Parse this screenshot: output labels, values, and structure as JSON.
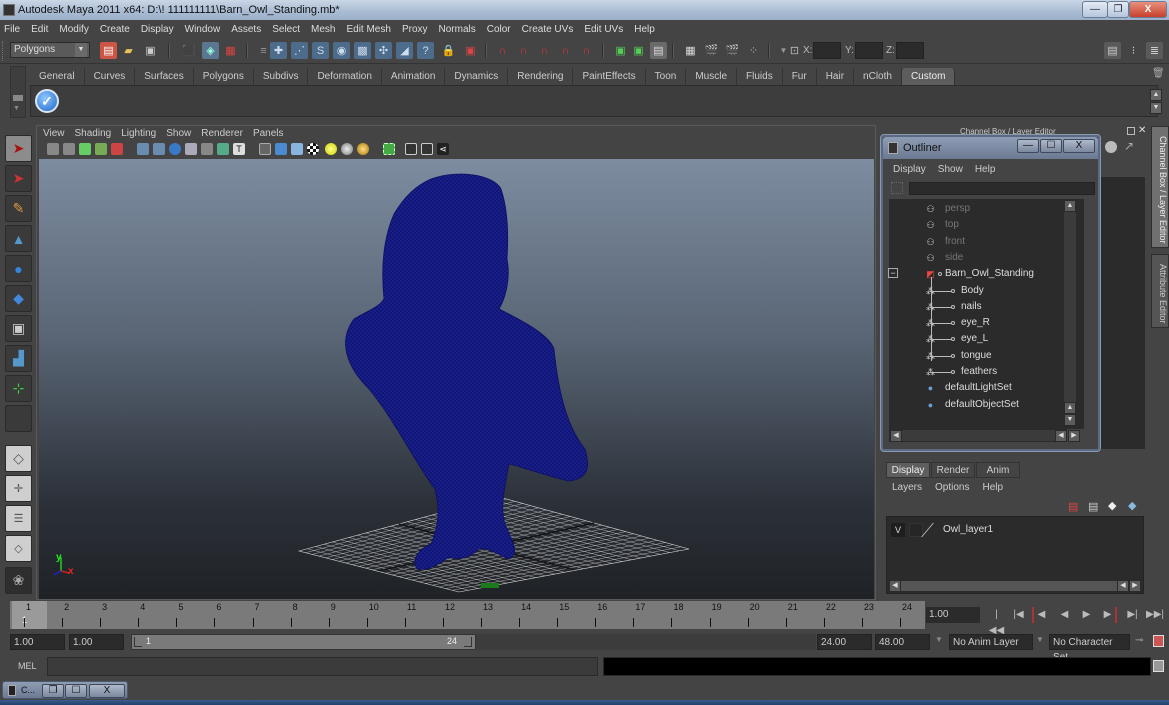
{
  "window": {
    "title": "Autodesk Maya 2011 x64: D:\\! 111111111\\Barn_Owl_Standing.mb*",
    "controls": {
      "minimize": "—",
      "restore": "❐",
      "close": "X"
    }
  },
  "menubar": [
    "File",
    "Edit",
    "Modify",
    "Create",
    "Display",
    "Window",
    "Assets",
    "Select",
    "Mesh",
    "Edit Mesh",
    "Proxy",
    "Normals",
    "Color",
    "Create UVs",
    "Edit UVs",
    "Help"
  ],
  "statusline": {
    "menu_set": "Polygons",
    "xyz_labels": [
      "X:",
      "Y:",
      "Z:"
    ],
    "xyz_values": [
      "",
      "",
      ""
    ]
  },
  "shelf": {
    "tabs": [
      "General",
      "Curves",
      "Surfaces",
      "Polygons",
      "Subdivs",
      "Deformation",
      "Animation",
      "Dynamics",
      "Rendering",
      "PaintEffects",
      "Toon",
      "Muscle",
      "Fluids",
      "Fur",
      "Hair",
      "nCloth",
      "Custom"
    ],
    "active_tab": "Custom",
    "items": [
      "checkmark-shelf-icon"
    ]
  },
  "viewport": {
    "menu": [
      "View",
      "Shading",
      "Lighting",
      "Show",
      "Renderer",
      "Panels"
    ],
    "axis_labels": {
      "y": "y",
      "x": "x"
    },
    "scene_object": "Barn_Owl_Standing",
    "wireframe_color": "#10157a"
  },
  "outliner": {
    "title": "Outliner",
    "menu": [
      "Display",
      "Show",
      "Help"
    ],
    "filter_value": "",
    "items": [
      {
        "label": "persp",
        "type": "camera",
        "dim": true,
        "indent": 0
      },
      {
        "label": "top",
        "type": "camera",
        "dim": true,
        "indent": 0
      },
      {
        "label": "front",
        "type": "camera",
        "dim": true,
        "indent": 0
      },
      {
        "label": "side",
        "type": "camera",
        "dim": true,
        "indent": 0
      },
      {
        "label": "Barn_Owl_Standing",
        "type": "group",
        "dim": false,
        "indent": 0,
        "expanded": true
      },
      {
        "label": "Body",
        "type": "mesh",
        "dim": false,
        "indent": 1
      },
      {
        "label": "nails",
        "type": "mesh",
        "dim": false,
        "indent": 1
      },
      {
        "label": "eye_R",
        "type": "mesh",
        "dim": false,
        "indent": 1
      },
      {
        "label": "eye_L",
        "type": "mesh",
        "dim": false,
        "indent": 1
      },
      {
        "label": "tongue",
        "type": "mesh",
        "dim": false,
        "indent": 1
      },
      {
        "label": "feathers",
        "type": "mesh",
        "dim": false,
        "indent": 1
      },
      {
        "label": "defaultLightSet",
        "type": "set",
        "dim": false,
        "indent": 0
      },
      {
        "label": "defaultObjectSet",
        "type": "set",
        "dim": false,
        "indent": 0
      }
    ],
    "collapse_glyph": "−"
  },
  "channel_box": {
    "title": "Channel Box / Layer Editor",
    "side_tabs": [
      "Channel Box / Layer Editor",
      "Attribute Editor"
    ]
  },
  "layer_editor": {
    "tabs": [
      "Display",
      "Render",
      "Anim"
    ],
    "active_tab": "Display",
    "menu": [
      "Layers",
      "Options",
      "Help"
    ],
    "layers": [
      {
        "visible": "V",
        "name": "Owl_layer1"
      }
    ]
  },
  "timeline": {
    "ticks": [
      "1",
      "2",
      "3",
      "4",
      "5",
      "6",
      "7",
      "8",
      "9",
      "10",
      "11",
      "12",
      "13",
      "14",
      "15",
      "16",
      "17",
      "18",
      "19",
      "20",
      "21",
      "22",
      "23",
      "24"
    ],
    "current_frame_marker": "1",
    "current_time": "1.00",
    "playback_buttons": [
      "go-to-start",
      "step-back-key",
      "step-back-frame",
      "play-backwards",
      "play-forwards",
      "step-forward-frame",
      "step-forward-key",
      "go-to-end"
    ]
  },
  "range": {
    "start_time": "1.00",
    "playback_start": "1.00",
    "range_start_label": "1",
    "range_end_label": "24",
    "playback_end": "24.00",
    "end_time": "48.00",
    "anim_layer": "No Anim Layer",
    "character_set": "No Character Set"
  },
  "command_line": {
    "label": "MEL",
    "input": "",
    "result": ""
  },
  "minimized_window": {
    "label": "C..."
  }
}
